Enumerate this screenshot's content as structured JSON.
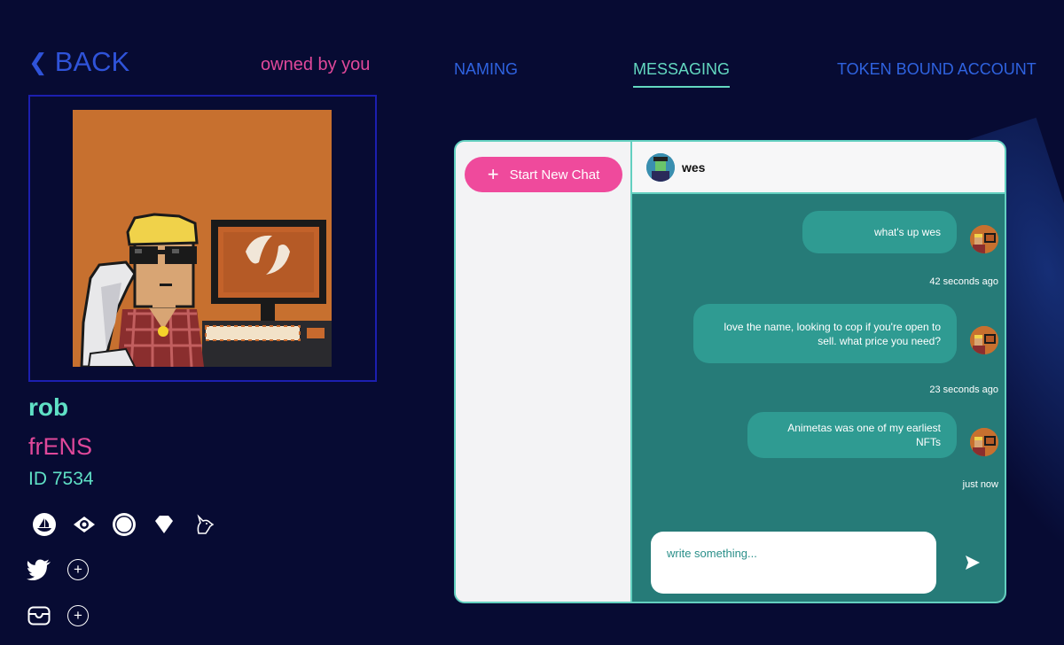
{
  "nav": {
    "back_label": "BACK",
    "owned_label": "owned by you"
  },
  "tabs": [
    {
      "label": "NAMING",
      "active": false
    },
    {
      "label": "MESSAGING",
      "active": true
    },
    {
      "label": "TOKEN BOUND ACCOUNT",
      "active": false
    }
  ],
  "profile": {
    "name": "rob",
    "collection": "frENS",
    "token_id": "ID 7534"
  },
  "market_icons": [
    "opensea-icon",
    "looksrare-eye-icon",
    "circle-logo-icon",
    "diamond-icon",
    "unicorn-icon"
  ],
  "social": [
    {
      "icon": "twitter-icon",
      "action": "add"
    },
    {
      "icon": "email-icon",
      "action": "add"
    }
  ],
  "chat": {
    "new_chat_label": "Start New Chat",
    "contact_name": "wes",
    "messages": [
      {
        "text": "what's up wes",
        "time": "42 seconds ago"
      },
      {
        "text": "love the name, looking to cop if you're open to sell. what price you need?",
        "time": "23 seconds ago"
      },
      {
        "text": "Animetas was one of my earliest NFTs",
        "time": "just now"
      }
    ],
    "composer_placeholder": "write something..."
  },
  "colors": {
    "background": "#070b33",
    "accent_pink": "#e0489a",
    "accent_teal": "#5fe0c5",
    "link_blue": "#2f53d9",
    "chat_bg": "#267b78",
    "bubble": "#2f9b92"
  }
}
